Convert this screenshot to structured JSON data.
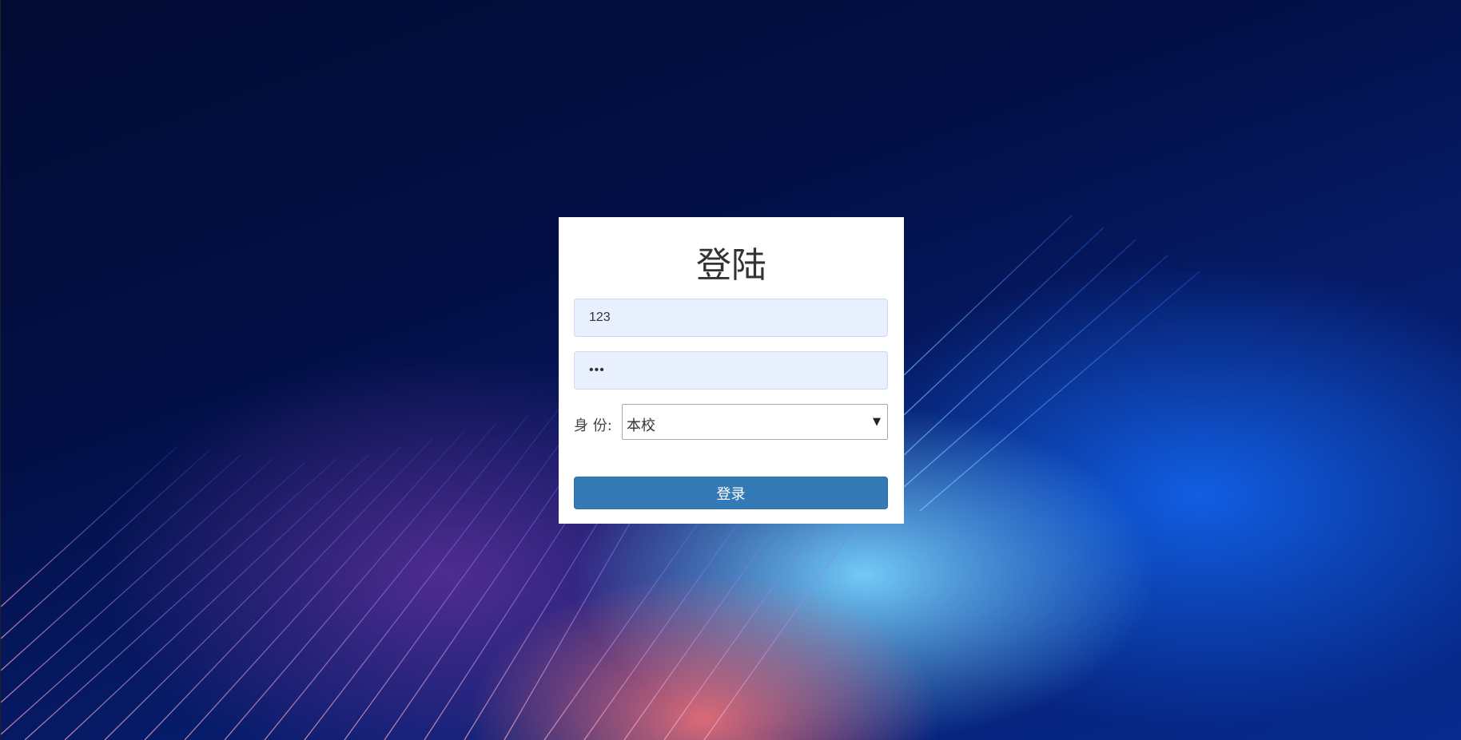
{
  "login": {
    "title": "登陆",
    "username_value": "123",
    "password_value": "•••",
    "identity_label": "身 份:",
    "identity_selected": "本校",
    "submit_label": "登录"
  },
  "icons": {
    "select_arrow": "chevron-down-icon"
  },
  "colors": {
    "background_dark": "#030f45",
    "card": "#ffffff",
    "input_fill": "#e8f0fe",
    "button_primary": "#337ab7"
  }
}
